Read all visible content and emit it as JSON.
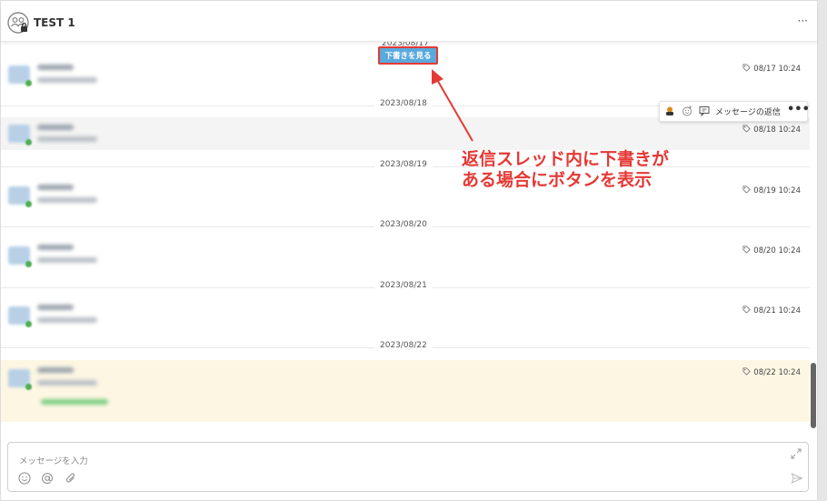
{
  "header": {
    "title": "TEST 1",
    "more_label": "···",
    "icons": {
      "group": "group-lock-icon",
      "more": "more-icon"
    }
  },
  "thread": {
    "top_date_partial": "2023/08/17",
    "draft_button": "下書きを見る",
    "groups": [
      {
        "date": "2023/08/18",
        "time": "08/18 10:24"
      },
      {
        "date": "2023/08/19",
        "time": "08/19 10:24"
      },
      {
        "date": "2023/08/20",
        "time": "08/20 10:24"
      },
      {
        "date": "2023/08/21",
        "time": "08/21 10:24"
      },
      {
        "date": "2023/08/22",
        "time": "08/22 10:24"
      }
    ],
    "first_time": "08/17 10:24"
  },
  "hover_toolbar": {
    "reply_label": "メッセージの返信",
    "more_label": "•••",
    "icons": [
      "reaction-person-icon",
      "emoji-add-icon",
      "reply-thread-icon",
      "more-icon"
    ]
  },
  "annotation": {
    "line1": "返信スレッド内に下書きが",
    "line2": "ある場合にボタンを表示"
  },
  "composer": {
    "placeholder": "メッセージを入力",
    "icons": [
      "emoji-icon",
      "mention-icon",
      "attach-icon",
      "expand-icon",
      "send-icon"
    ]
  },
  "colors": {
    "accent_blue": "#5aa9dc",
    "annotation_red": "#e53935",
    "highlight_bg": "#fdf6e3",
    "hover_bg": "#f4f4f4"
  }
}
